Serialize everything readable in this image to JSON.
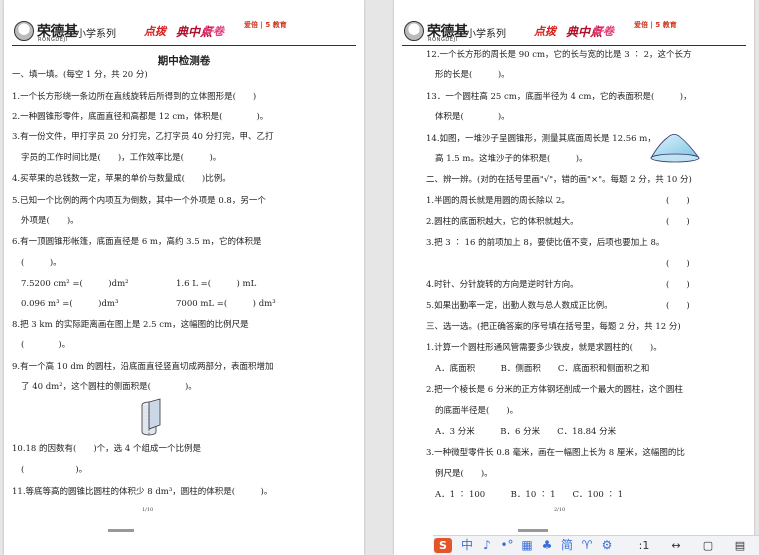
{
  "brand": {
    "name": "荣德基",
    "sub": "RONGDEJI",
    "series": "小学系列",
    "decos": [
      "点拨",
      "典中点",
      "好卷",
      "爱倍 | 5 教育"
    ]
  },
  "page1": {
    "title": "期中检测卷",
    "lines": [
      "一、填一填。(每空 1 分，共 20 分)",
      "1.一个长方形绕一条边所在直线旋转后所得到的立体图形是(　　)",
      "2.一种圆锥形零件，底面直径和高都是 12 cm，体积是(　　　　)。",
      "3.有一份文件，甲打字员 20 分打完，乙打字员 40 分打完，甲、乙打",
      "字员的工作时间比是(　　)，工作效率比是(　　　)。",
      "4.买苹果的总钱数一定，苹果的单价与数量成(　　)比例。",
      "5.已知一个比例的两个内项互为倒数，其中一个外项是 0.8，另一个",
      "外项是(　　)。",
      "6.有一顶圆锥形帐篷，底面直径是 6 m，高约 3.5 m，它的体积是",
      "(　　　)。",
      "7.5200 cm² =(　　　)dm²",
      "1.6 L =(　　　) mL",
      "0.096 m³ =(　　　)dm³",
      "7000 mL =(　　　) dm³",
      "8.把 3 km 的实际距离画在图上是 2.5 cm，这幅图的比例尺是",
      "(　　　　)。",
      "9.有一个高 10 dm 的圆柱，沿底面直径竖直切成两部分，表面积增加",
      "了 40 dm²，这个圆柱的侧面积是(　　　　)。",
      "10.18 的因数有(　　)个，选 4 个组成一个比例是",
      "(　　　　　　)。",
      "11.等底等高的圆锥比圆柱的体积少 8 dm³，圆柱的体积是(　　　)。"
    ],
    "page_number": "1/10"
  },
  "page2": {
    "lines": [
      "12.一个长方形的周长是 90 cm，它的长与宽的比是 3 ∶ 2，这个长方",
      "形的长是(　　　)。",
      "13．一个圆柱高 25 cm，底面半径为 4 cm，它的表面积是(　　　)，",
      "体积是(　　　　)。",
      "14.如图，一堆沙子呈圆锥形，测量其底面周长是 12.56 m，",
      "高 1.5 m。这堆沙子的体积是(　　　)。",
      "二、辨一辨。(对的在括号里画\"√\"，错的画\"×\"。每题 2 分，共 10 分)",
      "1.半圆的周长就是用圆的周长除以 2。",
      "2.圆柱的底面积越大，它的体积就越大。",
      "3.把 3 ∶ 16 的前项加上 8，要使比值不变，后项也要加上 8。",
      "4.时针、分针旋转的方向是逆时针方向。",
      "5.如果出勤率一定，出勤人数与总人数成正比例。",
      "三、选一选。(把正确答案的序号填在括号里，每题 2 分，共 12 分)",
      "1.计算一个圆柱形通风管需要多少铁皮，就是求圆柱的(　　)。",
      "A．底面积　　　B．侧面积　　C．底面积和侧面积之和",
      "2.把一个棱长是 6 分米的正方体钢坯削成一个最大的圆柱，这个圆柱",
      "的底面半径是(　　)。",
      "A．3 分米　　　B．6 分米　　C．18.84 分米",
      "3.一种微型零件长 0.8 毫米，画在一幅图上长为 8 厘米，这幅图的比",
      "例尺是(　　)。",
      "A．1 ∶ 100　　　B．10 ∶ 1　　C．100 ∶ 1"
    ],
    "judge_brackets": [
      "(　　)",
      "(　　)",
      "(　　)",
      "(　　)",
      "(　　)"
    ],
    "page_number": "2/10"
  },
  "taskbar": {
    "items": [
      "中",
      "♪",
      "•°",
      "▦",
      "♣",
      "简",
      "♈",
      "⚙",
      ":1",
      "↔",
      "▢",
      "▤"
    ]
  }
}
